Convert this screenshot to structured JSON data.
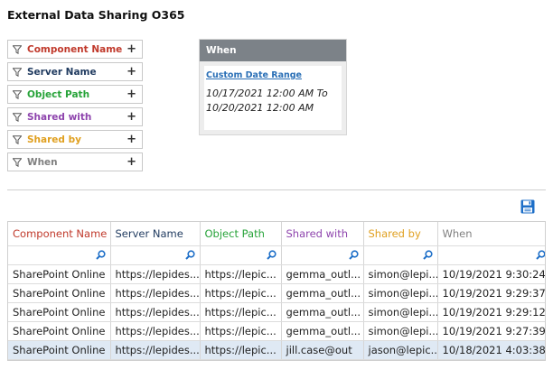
{
  "page_title": "External Data Sharing O365",
  "filters": [
    {
      "label": "Component Name",
      "color": "#c0392b"
    },
    {
      "label": "Server Name",
      "color": "#1f3a5f"
    },
    {
      "label": "Object Path",
      "color": "#27a339"
    },
    {
      "label": "Shared with",
      "color": "#8e44ad"
    },
    {
      "label": "Shared by",
      "color": "#e0a020"
    },
    {
      "label": "When",
      "color": "#7f7f7f"
    }
  ],
  "filter_add_symbol": "+",
  "when_panel": {
    "title": "When",
    "link_label": "Custom Date Range",
    "range_text": "10/17/2021 12:00 AM To 10/20/2021 12:00 AM"
  },
  "table": {
    "columns": [
      {
        "label": "Component Name",
        "color": "#c0392b"
      },
      {
        "label": "Server Name",
        "color": "#1f3a5f"
      },
      {
        "label": "Object Path",
        "color": "#27a339"
      },
      {
        "label": "Shared with",
        "color": "#8e44ad"
      },
      {
        "label": "Shared by",
        "color": "#e0a020"
      },
      {
        "label": "When",
        "color": "#7f7f7f"
      }
    ],
    "rows": [
      [
        "SharePoint Online",
        "https://lepides...",
        "https://lepic...",
        "gemma_outl...",
        "simon@lepi...",
        "10/19/2021 9:30:24"
      ],
      [
        "SharePoint Online",
        "https://lepides...",
        "https://lepic...",
        "gemma_outl...",
        "simon@lepi...",
        "10/19/2021 9:29:37"
      ],
      [
        "SharePoint Online",
        "https://lepides...",
        "https://lepic...",
        "gemma_outl...",
        "simon@lepi...",
        "10/19/2021 9:29:12"
      ],
      [
        "SharePoint Online",
        "https://lepides...",
        "https://lepic...",
        "gemma_outl...",
        "simon@lepi...",
        "10/19/2021 9:27:39"
      ],
      [
        "SharePoint Online",
        "https://lepides...",
        "https://lepic...",
        "jill.case@out",
        "jason@lepic...",
        "10/18/2021 4:03:38"
      ]
    ],
    "selected_row": 4
  },
  "icons": {
    "filter": "funnel-icon",
    "add": "plus-icon",
    "search": "magnifier-icon",
    "save": "save-icon"
  },
  "colors": {
    "panel_header": "#7c8288",
    "link": "#2a6fb6",
    "selected_row": "#dfe9f4",
    "save_icon": "#1e6fc8",
    "search_icon": "#1e6fc8"
  }
}
